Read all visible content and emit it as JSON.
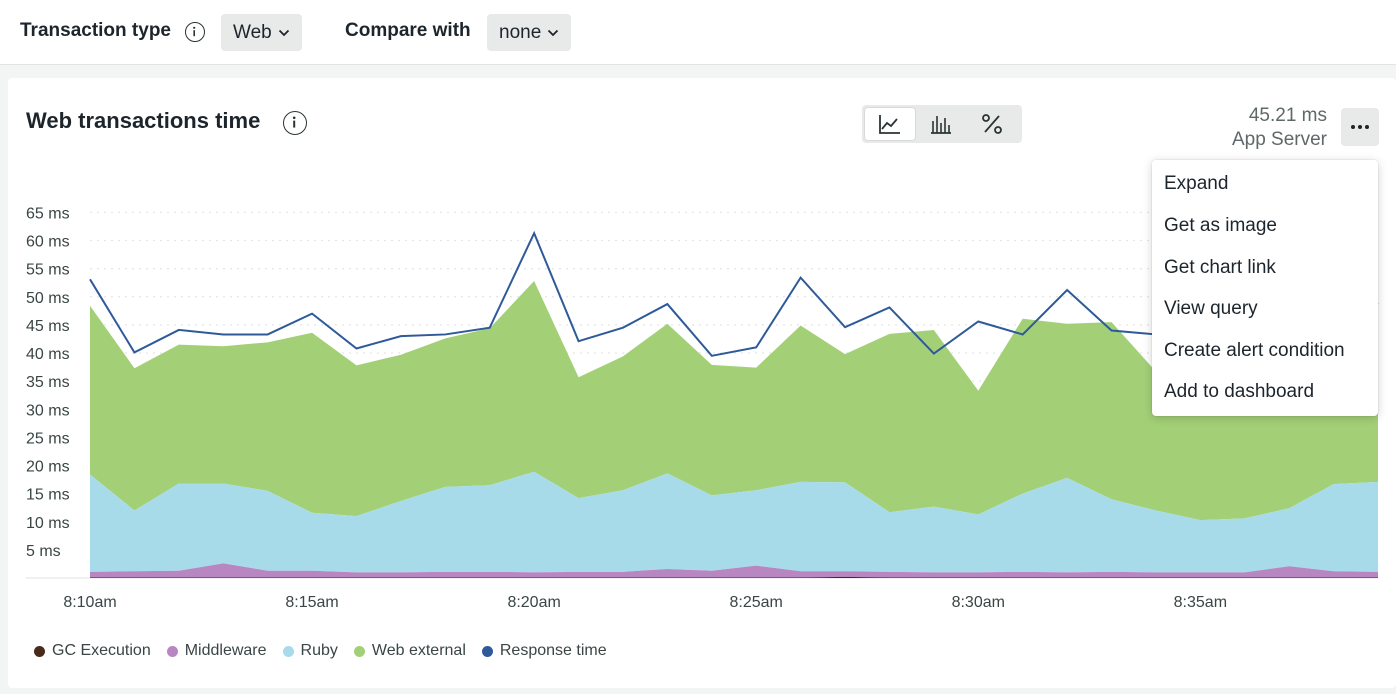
{
  "filters": {
    "transaction_type_label": "Transaction type",
    "transaction_type_value": "Web",
    "compare_with_label": "Compare with",
    "compare_with_value": "none"
  },
  "card": {
    "title": "Web transactions time",
    "summary_value": "45.21 ms",
    "summary_label": "App Server",
    "chart_types": [
      {
        "icon": "area-chart-icon",
        "active": true
      },
      {
        "icon": "bar-chart-icon",
        "active": false
      },
      {
        "icon": "percent-icon",
        "active": false
      }
    ],
    "more_icon": "ellipsis-icon"
  },
  "menu": {
    "items": [
      "Expand",
      "Get as image",
      "Get chart link",
      "View query",
      "Create alert condition",
      "Add to dashboard"
    ]
  },
  "colors": {
    "gc_execution": "#4a2a1a",
    "middleware": "#b886c1",
    "ruby": "#a8dbea",
    "web_external": "#a3d077",
    "response_time": "#2e5a99"
  },
  "chart_data": {
    "type": "area",
    "stacked": true,
    "x": [
      "8:10am",
      "8:11am",
      "8:12am",
      "8:13am",
      "8:14am",
      "8:15am",
      "8:16am",
      "8:17am",
      "8:18am",
      "8:19am",
      "8:20am",
      "8:21am",
      "8:22am",
      "8:23am",
      "8:24am",
      "8:25am",
      "8:26am",
      "8:27am",
      "8:28am",
      "8:29am",
      "8:30am",
      "8:31am",
      "8:32am",
      "8:33am",
      "8:34am",
      "8:35am",
      "8:36am",
      "8:37am",
      "8:38am",
      "8:39am"
    ],
    "x_tick_labels": [
      "8:10am",
      "8:15am",
      "8:20am",
      "8:25am",
      "8:30am",
      "8:35am"
    ],
    "y_tick_labels": [
      "5 ms",
      "10 ms",
      "15 ms",
      "20 ms",
      "25 ms",
      "30 ms",
      "35 ms",
      "40 ms",
      "45 ms",
      "50 ms",
      "55 ms",
      "60 ms",
      "65 ms"
    ],
    "ylim": [
      0,
      65
    ],
    "grid": true,
    "legend_position": "bottom-left",
    "series": [
      {
        "name": "GC Execution",
        "values": [
          0.1,
          0.1,
          0.1,
          0.1,
          0.1,
          0.1,
          0.1,
          0.1,
          0.1,
          0.1,
          0.1,
          0.1,
          0.1,
          0.1,
          0.1,
          0.1,
          0.1,
          0.2,
          0.1,
          0.1,
          0.1,
          0.1,
          0.1,
          0.1,
          0.1,
          0.1,
          0.1,
          0.1,
          0.1,
          0.1
        ]
      },
      {
        "name": "Middleware",
        "values": [
          1.0,
          1.1,
          1.2,
          2.5,
          1.2,
          1.2,
          0.9,
          0.9,
          1.0,
          1.0,
          0.9,
          1.0,
          1.0,
          1.5,
          1.2,
          2.1,
          1.1,
          1.0,
          1.0,
          0.9,
          0.9,
          1.0,
          0.9,
          1.0,
          0.9,
          0.9,
          0.9,
          2.0,
          1.1,
          1.0
        ]
      },
      {
        "name": "Ruby",
        "values": [
          17.3,
          10.8,
          15.5,
          14.2,
          14.2,
          10.3,
          10.0,
          12.7,
          15.1,
          15.4,
          17.9,
          13.1,
          14.5,
          17.0,
          13.4,
          13.4,
          15.9,
          15.8,
          10.6,
          11.7,
          10.3,
          13.9,
          16.8,
          12.9,
          11.0,
          9.3,
          9.6,
          10.3,
          15.5,
          16.0
        ]
      },
      {
        "name": "Web external",
        "values": [
          30.0,
          25.3,
          24.7,
          24.4,
          26.4,
          32.0,
          26.8,
          26.0,
          26.4,
          27.9,
          33.9,
          21.5,
          23.8,
          26.6,
          23.2,
          21.8,
          27.8,
          22.8,
          31.7,
          31.4,
          22.0,
          31.1,
          27.4,
          31.5,
          24.7,
          21.3,
          21.6,
          22.8,
          25.8,
          27.7
        ]
      },
      {
        "name": "Response time",
        "values": [
          53.1,
          40.1,
          44.1,
          43.3,
          43.3,
          47.0,
          40.8,
          43.0,
          43.3,
          44.5,
          61.3,
          42.1,
          44.5,
          48.7,
          39.5,
          41.0,
          53.4,
          44.6,
          48.1,
          39.9,
          45.6,
          43.3,
          51.2,
          44.0,
          43.3,
          42.2,
          40.0,
          39.4,
          45.5,
          48.9
        ]
      }
    ]
  }
}
